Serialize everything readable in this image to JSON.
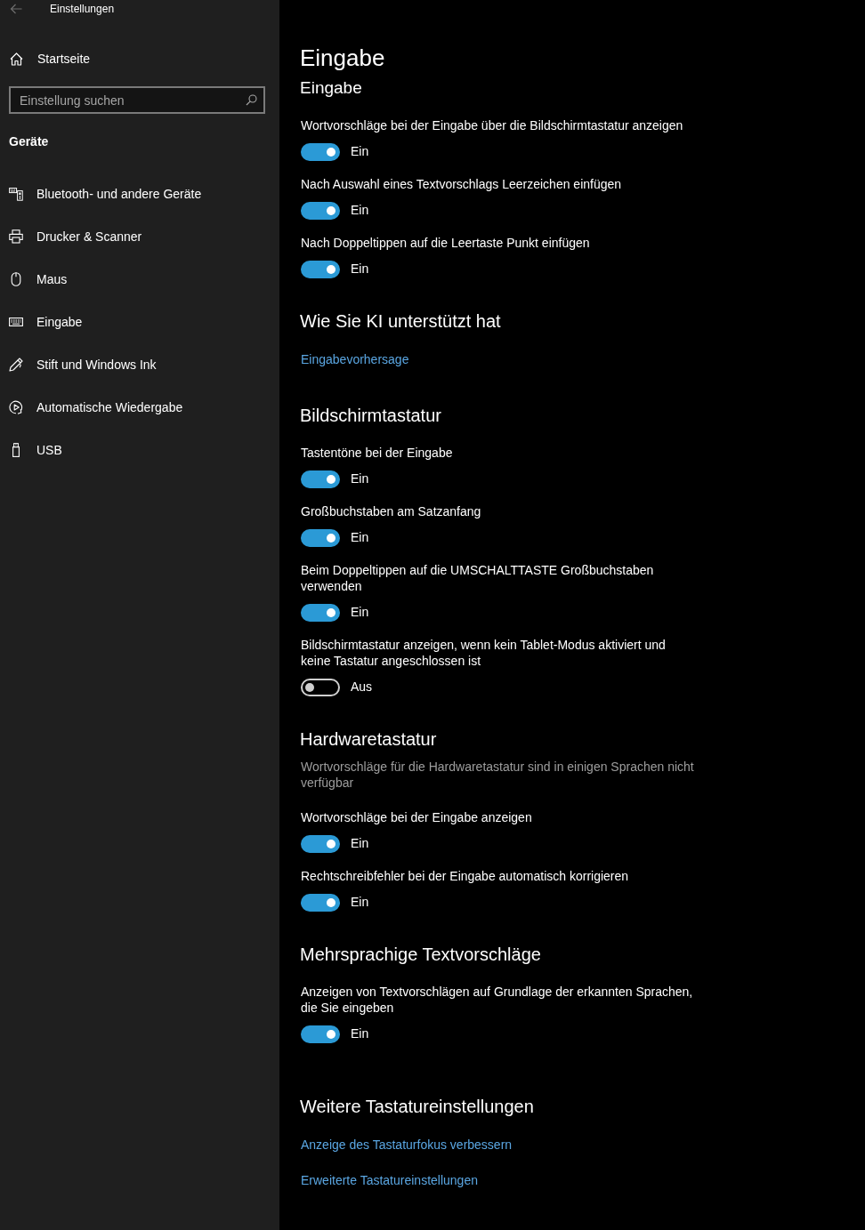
{
  "window": {
    "title": "Einstellungen"
  },
  "sidebar": {
    "home": "Startseite",
    "search": {
      "placeholder": "Einstellung suchen"
    },
    "category": "Geräte",
    "items": [
      {
        "label": "Bluetooth- und andere Geräte"
      },
      {
        "label": "Drucker & Scanner"
      },
      {
        "label": "Maus"
      },
      {
        "label": "Eingabe"
      },
      {
        "label": "Stift und Windows Ink"
      },
      {
        "label": "Automatische Wiedergabe"
      },
      {
        "label": "USB"
      }
    ]
  },
  "page": {
    "title": "Eingabe",
    "sections": [
      {
        "heading": "Eingabe",
        "items": [
          {
            "kind": "toggle",
            "label": "Wortvorschläge bei der Eingabe über die Bildschirmtastatur anzeigen",
            "on": true,
            "state_text": "Ein"
          },
          {
            "kind": "toggle",
            "label": "Nach Auswahl eines Textvorschlags Leerzeichen einfügen",
            "on": true,
            "state_text": "Ein"
          },
          {
            "kind": "toggle",
            "label": "Nach Doppeltippen auf die Leertaste Punkt einfügen",
            "on": true,
            "state_text": "Ein"
          }
        ]
      },
      {
        "heading": "Wie Sie KI unterstützt hat",
        "items": [
          {
            "kind": "link",
            "label": "Eingabevorhersage"
          }
        ]
      },
      {
        "heading": "Bildschirmtastatur",
        "items": [
          {
            "kind": "toggle",
            "label": "Tastentöne bei der Eingabe",
            "on": true,
            "state_text": "Ein"
          },
          {
            "kind": "toggle",
            "label": "Großbuchstaben am Satzanfang",
            "on": true,
            "state_text": "Ein"
          },
          {
            "kind": "toggle",
            "label": "Beim Doppeltippen auf die UMSCHALTTASTE Großbuchstaben verwenden",
            "on": true,
            "state_text": "Ein"
          },
          {
            "kind": "toggle",
            "label": "Bildschirmtastatur anzeigen, wenn kein Tablet-Modus aktiviert und keine Tastatur angeschlossen ist",
            "on": false,
            "state_text": "Aus"
          }
        ]
      },
      {
        "heading": "Hardwaretastatur",
        "description": "Wortvorschläge für die Hardwaretastatur sind in einigen Sprachen nicht verfügbar",
        "items": [
          {
            "kind": "toggle",
            "label": "Wortvorschläge bei der Eingabe anzeigen",
            "on": true,
            "state_text": "Ein"
          },
          {
            "kind": "toggle",
            "label": "Rechtschreibfehler bei der Eingabe automatisch korrigieren",
            "on": true,
            "state_text": "Ein"
          }
        ]
      },
      {
        "heading": "Mehrsprachige Textvorschläge",
        "items": [
          {
            "kind": "toggle",
            "label": "Anzeigen von Textvorschlägen auf Grundlage der erkannten Sprachen, die Sie eingeben",
            "on": true,
            "state_text": "Ein"
          }
        ]
      },
      {
        "heading": "Weitere Tastatureinstellungen",
        "items": [
          {
            "kind": "link",
            "label": "Anzeige des Tastaturfokus verbessern"
          },
          {
            "kind": "link",
            "label": "Erweiterte Tastatureinstellungen"
          }
        ]
      }
    ]
  }
}
